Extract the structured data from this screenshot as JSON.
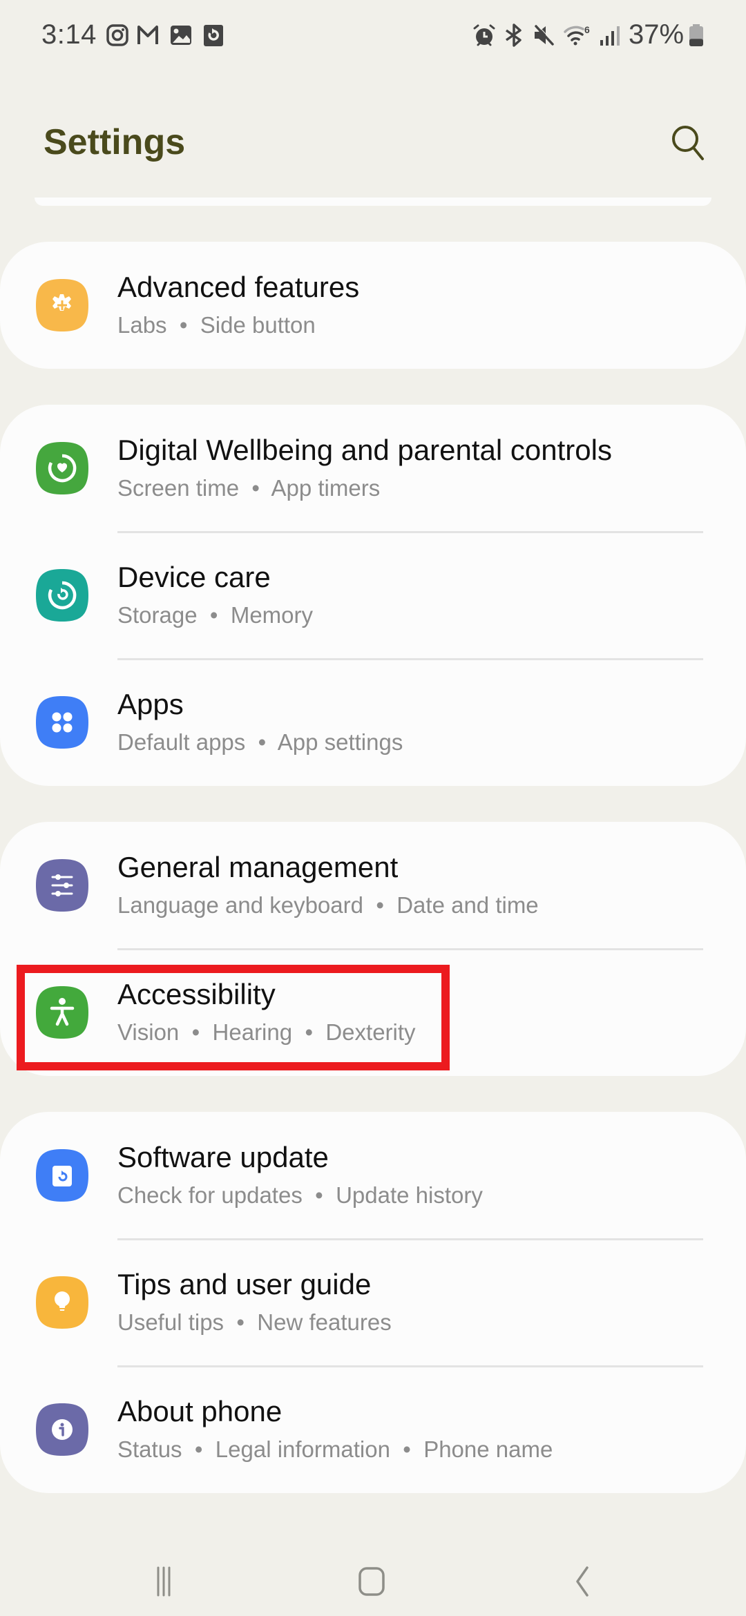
{
  "status_bar": {
    "time": "3:14",
    "left_icons": [
      "instagram-icon",
      "gmail-icon",
      "gallery-icon",
      "app-update-icon"
    ],
    "right_icons": [
      "alarm-icon",
      "bluetooth-icon",
      "mute-icon",
      "wifi-6-icon",
      "signal-icon"
    ],
    "battery_percent": "37%",
    "battery_level": 0.37
  },
  "header": {
    "title": "Settings",
    "search_icon": "search-icon"
  },
  "colors": {
    "background": "#f1f0ea",
    "card": "#fcfcfc",
    "title": "#4a4a1c",
    "subtitle": "#8c8c8c",
    "highlight": "#ec1b1f"
  },
  "groups": [
    {
      "items": [
        {
          "title": "Advanced features",
          "subtitle_parts": [
            "Labs",
            "Side button"
          ],
          "icon": "advanced-features-icon",
          "icon_color": "#f8b84a"
        }
      ]
    },
    {
      "items": [
        {
          "title": "Digital Wellbeing and parental controls",
          "subtitle_parts": [
            "Screen time",
            "App timers"
          ],
          "icon": "digital-wellbeing-icon",
          "icon_color": "#45a73e"
        },
        {
          "title": "Device care",
          "subtitle_parts": [
            "Storage",
            "Memory"
          ],
          "icon": "device-care-icon",
          "icon_color": "#1aa897"
        },
        {
          "title": "Apps",
          "subtitle_parts": [
            "Default apps",
            "App settings"
          ],
          "icon": "apps-icon",
          "icon_color": "#3f7ef6"
        }
      ]
    },
    {
      "items": [
        {
          "title": "General management",
          "subtitle_parts": [
            "Language and keyboard",
            "Date and time"
          ],
          "icon": "general-management-icon",
          "icon_color": "#6b6aa8"
        },
        {
          "title": "Accessibility",
          "subtitle_parts": [
            "Vision",
            "Hearing",
            "Dexterity"
          ],
          "icon": "accessibility-icon",
          "icon_color": "#43a93c",
          "highlighted": true
        }
      ]
    },
    {
      "items": [
        {
          "title": "Software update",
          "subtitle_parts": [
            "Check for updates",
            "Update history"
          ],
          "icon": "software-update-icon",
          "icon_color": "#3f7ef6"
        },
        {
          "title": "Tips and user guide",
          "subtitle_parts": [
            "Useful tips",
            "New features"
          ],
          "icon": "tips-icon",
          "icon_color": "#f8b63c"
        },
        {
          "title": "About phone",
          "subtitle_parts": [
            "Status",
            "Legal information",
            "Phone name"
          ],
          "icon": "about-phone-icon",
          "icon_color": "#6b6aa8"
        }
      ]
    }
  ],
  "subtitle_separator": "  •  ",
  "nav_bar": {
    "buttons": [
      "recents-icon",
      "home-icon",
      "back-icon"
    ]
  }
}
